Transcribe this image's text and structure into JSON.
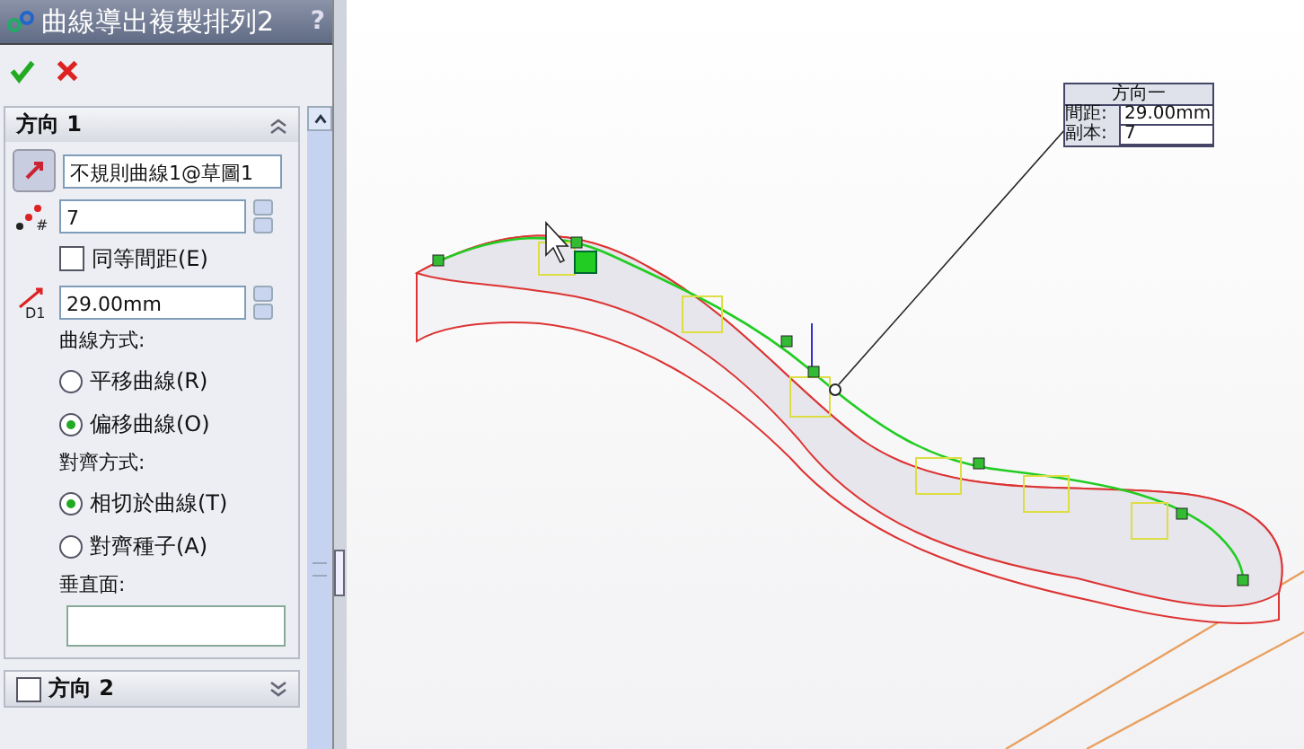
{
  "panel": {
    "title": "曲線導出複製排列2",
    "help": "?"
  },
  "direction1": {
    "title": "方向 1",
    "expanded": true,
    "curve_field": {
      "value": "不規則曲線1@草圖1"
    },
    "count_icon_text": "#",
    "count_field": {
      "value": "7"
    },
    "spacing_icon_text": "D1",
    "equal_spacing": {
      "label": "同等間距(E)",
      "checked": false
    },
    "spacing_field": {
      "value": "29.00mm"
    },
    "curve_method": {
      "label": "曲線方式:",
      "options": [
        {
          "label": "平移曲線(R)",
          "selected": false
        },
        {
          "label": "偏移曲線(O)",
          "selected": true
        }
      ]
    },
    "alignment": {
      "label": "對齊方式:",
      "options": [
        {
          "label": "相切於曲線(T)",
          "selected": true
        },
        {
          "label": "對齊種子(A)",
          "selected": false
        }
      ]
    },
    "normal_plane": {
      "label": "垂直面:"
    }
  },
  "direction2": {
    "title": "方向 2",
    "checked": false,
    "expanded": false
  },
  "callout": {
    "title": "方向一",
    "rows": [
      {
        "label": "間距:",
        "value": "29.00mm"
      },
      {
        "label": "副本:",
        "value": "7"
      }
    ]
  }
}
